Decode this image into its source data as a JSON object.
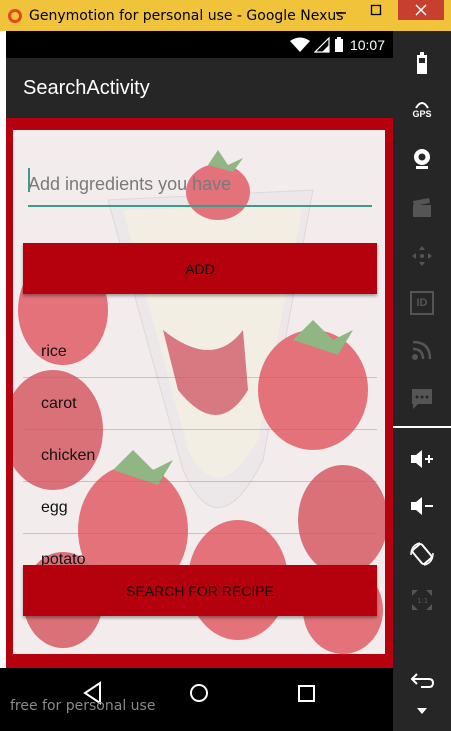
{
  "window": {
    "title": "Genymotion for personal use - Google Nexus",
    "minimize_icon": "minimize-icon",
    "maximize_icon": "maximize-icon",
    "close_icon": "close-icon"
  },
  "statusbar": {
    "clock": "10:07",
    "icons": [
      "wifi-icon",
      "signal-icon",
      "battery-icon"
    ]
  },
  "appbar": {
    "title": "SearchActivity"
  },
  "form": {
    "placeholder": "Add ingredients you have",
    "value": "",
    "add_label": "ADD",
    "search_label": "SEARCH FOR RECIPE"
  },
  "ingredients": [
    "rice",
    "carot",
    "chicken",
    "egg",
    "potato"
  ],
  "navbar": {
    "watermark": "free for personal use",
    "buttons": [
      "back-icon",
      "home-icon",
      "recents-icon"
    ]
  },
  "sidepanel": {
    "gps_label": "GPS",
    "id_label": "ID",
    "icons": [
      "battery-icon",
      "gps-icon",
      "camera-icon",
      "clapper-icon",
      "dpad-icon",
      "id-icon",
      "rss-icon",
      "sms-icon",
      "volume-up-icon",
      "volume-down-icon",
      "rotate-icon",
      "scale-icon",
      "back-icon",
      "menu-icon"
    ]
  },
  "colors": {
    "accent_red": "#b5000e",
    "title_bar": "#f0c33a",
    "underline": "#3e9a8c"
  }
}
